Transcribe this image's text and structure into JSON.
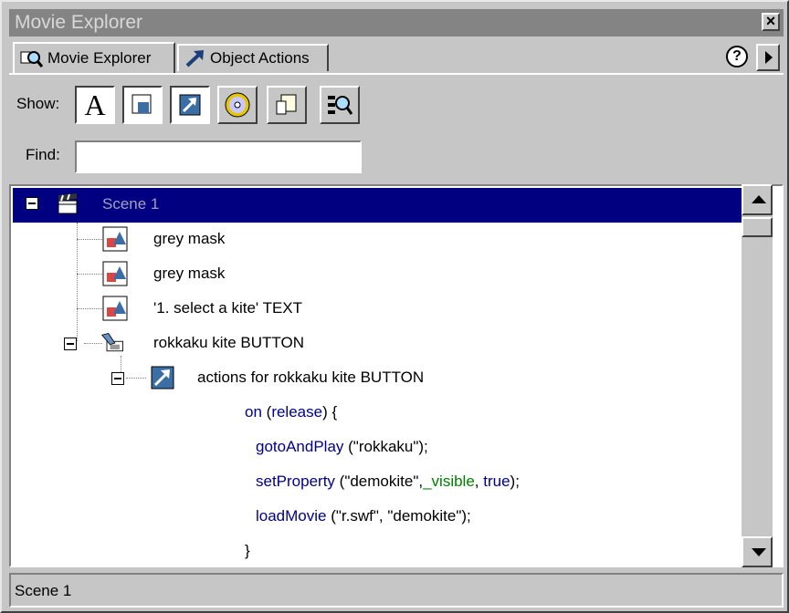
{
  "window": {
    "title": "Movie Explorer"
  },
  "tabs": [
    {
      "label": "Movie Explorer",
      "icon": "movie-explorer-icon",
      "active": true
    },
    {
      "label": "Object Actions",
      "icon": "action-arrow-icon",
      "active": false
    }
  ],
  "help_label": "?",
  "show": {
    "label": "Show:",
    "buttons": [
      {
        "name": "show-text-button",
        "glyph": "A",
        "pressed": true
      },
      {
        "name": "show-buttons-movieclips-button",
        "glyph": "",
        "pressed": true
      },
      {
        "name": "show-actions-button",
        "glyph": "",
        "pressed": true
      },
      {
        "name": "show-media-button",
        "glyph": "",
        "pressed": false
      },
      {
        "name": "show-frames-layers-button",
        "glyph": "",
        "pressed": false
      },
      {
        "name": "customize-show-button",
        "glyph": "",
        "pressed": false
      }
    ]
  },
  "find": {
    "label": "Find:",
    "value": ""
  },
  "tree": {
    "scene": "Scene 1",
    "items": [
      {
        "label": "grey mask"
      },
      {
        "label": "grey mask"
      },
      {
        "label": "'1. select a kite' TEXT"
      },
      {
        "label": "rokkaku kite BUTTON"
      },
      {
        "label": "actions for rokkaku kite BUTTON"
      }
    ],
    "code": {
      "line1_kw": "on",
      "line1_rest": " (",
      "line1_kw2": "release",
      "line1_end": ") {",
      "line2_kw": "gotoAndPlay",
      "line2_rest": " (\"rokkaku\");",
      "line3_kw": "setProperty",
      "line3_a": " (\"demokite\",",
      "line3_prop": "_visible",
      "line3_b": ", ",
      "line3_true": "true",
      "line3_end": ");",
      "line4_kw": "loadMovie",
      "line4_rest": " (\"r.swf\", \"demokite\");",
      "line5": "}"
    }
  },
  "status": {
    "text": "Scene 1"
  },
  "colors": {
    "selection": "#000080",
    "keyword": "#00008b",
    "property": "#008000"
  }
}
